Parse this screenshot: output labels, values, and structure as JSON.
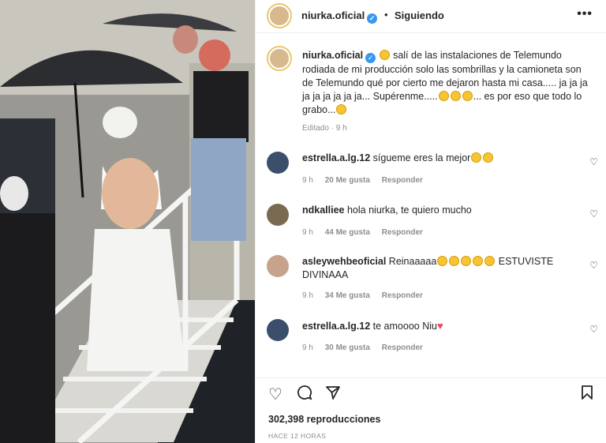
{
  "header": {
    "username": "niurka.oficial",
    "dot": "•",
    "follow_status": "Siguiendo",
    "more": "•••"
  },
  "caption": {
    "username": "niurka.oficial",
    "text_1": "salí de las instalaciones de Telemundo rodiada de mi producción solo las sombrillas y la camioneta son de Telemundo qué por cierto me dejaron hasta mi casa..... ja ja ja ja ja ja ja ja ja... Supérenme.....",
    "text_2": "... es por eso que todo lo grabo...",
    "time": "Editado · 9 h"
  },
  "comments": [
    {
      "username": "estrella.a.lg.12",
      "text": "sígueme eres la mejor",
      "time": "9 h",
      "likes": "20 Me gusta",
      "reply": "Responder"
    },
    {
      "username": "ndkalliee",
      "text": "hola niurka, te quiero mucho",
      "time": "9 h",
      "likes": "44 Me gusta",
      "reply": "Responder"
    },
    {
      "username": "asleywehbeoficial",
      "text": "Reinaaaaa",
      "text_2": "ESTUVISTE DIVINAAA",
      "time": "9 h",
      "likes": "34 Me gusta",
      "reply": "Responder"
    },
    {
      "username": "estrella.a.lg.12",
      "text": "te amoooo Niu",
      "time": "9 h",
      "likes": "30 Me gusta",
      "reply": "Responder"
    }
  ],
  "footer": {
    "views": "302,398 reproducciones",
    "ago": "HACE 12 HORAS"
  },
  "icons": {
    "like": "heart-icon",
    "comment": "comment-icon",
    "share": "share-icon",
    "save": "bookmark-icon"
  },
  "colors": {
    "verified": "#3897f0",
    "secondary_text": "#8e8e8e",
    "heart": "#ed4956"
  }
}
